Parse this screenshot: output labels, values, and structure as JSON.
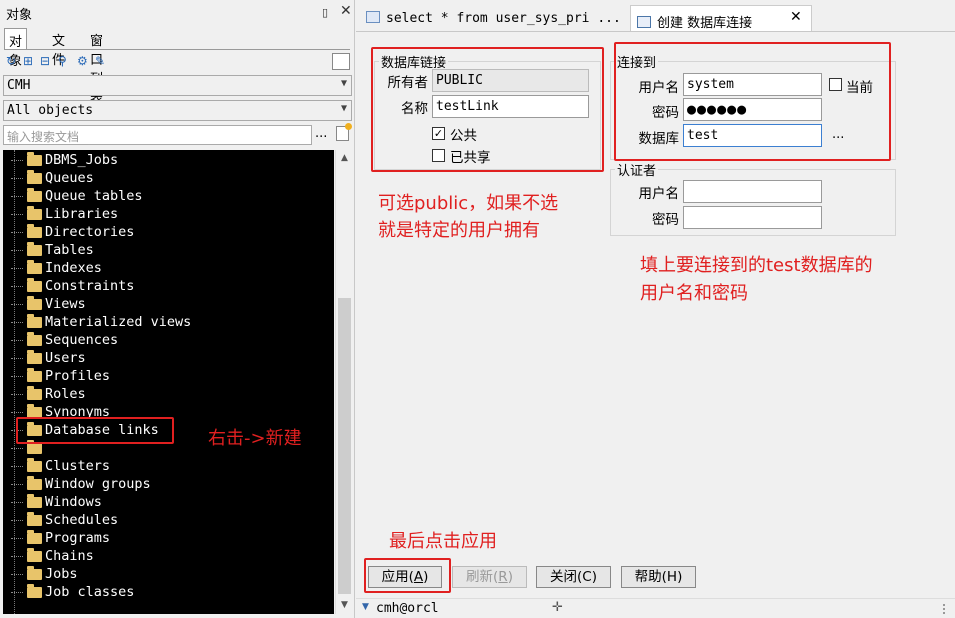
{
  "left_panel": {
    "title": "对象",
    "tabs": [
      "对象",
      "文件",
      "窗口列表"
    ],
    "owner_combo": "CMH",
    "scope_combo": "All objects",
    "search_placeholder": "输入搜索文档",
    "search_more": "...",
    "tree_items": [
      "DBMS_Jobs",
      "Queues",
      "Queue tables",
      "Libraries",
      "Directories",
      "Tables",
      "Indexes",
      "Constraints",
      "Views",
      "Materialized views",
      "Sequences",
      "Users",
      "Profiles",
      "Roles",
      "Synonyms",
      "Database links",
      "",
      "Clusters",
      "Window groups",
      "Windows",
      "Schedules",
      "Programs",
      "Chains",
      "Jobs",
      "Job classes"
    ]
  },
  "doc_tabs": {
    "sql_tab": "select * from user_sys_pri ...",
    "create_tab": "创建 数据库连接"
  },
  "db_link": {
    "legend": "数据库链接",
    "owner_label": "所有者",
    "owner_value": "PUBLIC",
    "name_label": "名称",
    "name_value": "testLink",
    "public_label": "公共",
    "public_checked": true,
    "shared_label": "已共享",
    "shared_checked": false
  },
  "connect_to": {
    "legend": "连接到",
    "user_label": "用户名",
    "user_value": "system",
    "current_label": "当前",
    "password_label": "密码",
    "password_value": "●●●●●●",
    "database_label": "数据库",
    "database_value": "test",
    "more": "..."
  },
  "authenticator": {
    "legend": "认证者",
    "user_label": "用户名",
    "user_value": "",
    "password_label": "密码",
    "password_value": ""
  },
  "annotations": {
    "right_click": "右击->新建",
    "public_note_1": "可选public，如果不选",
    "public_note_2": "就是特定的用户拥有",
    "fill_note_1": "填上要连接到的test数据库的",
    "fill_note_2": "用户名和密码",
    "apply_note": "最后点击应用"
  },
  "buttons": {
    "apply_text": "应用",
    "apply_key": "A",
    "refresh_text": "刷新",
    "refresh_key": "R",
    "close": "关闭(C)",
    "help": "帮助(H)"
  },
  "status": {
    "connection": "cmh@orcl"
  },
  "colors": {
    "annotation": "#e02020",
    "tree_bg": "#000000",
    "folder": "#e8c46a"
  }
}
